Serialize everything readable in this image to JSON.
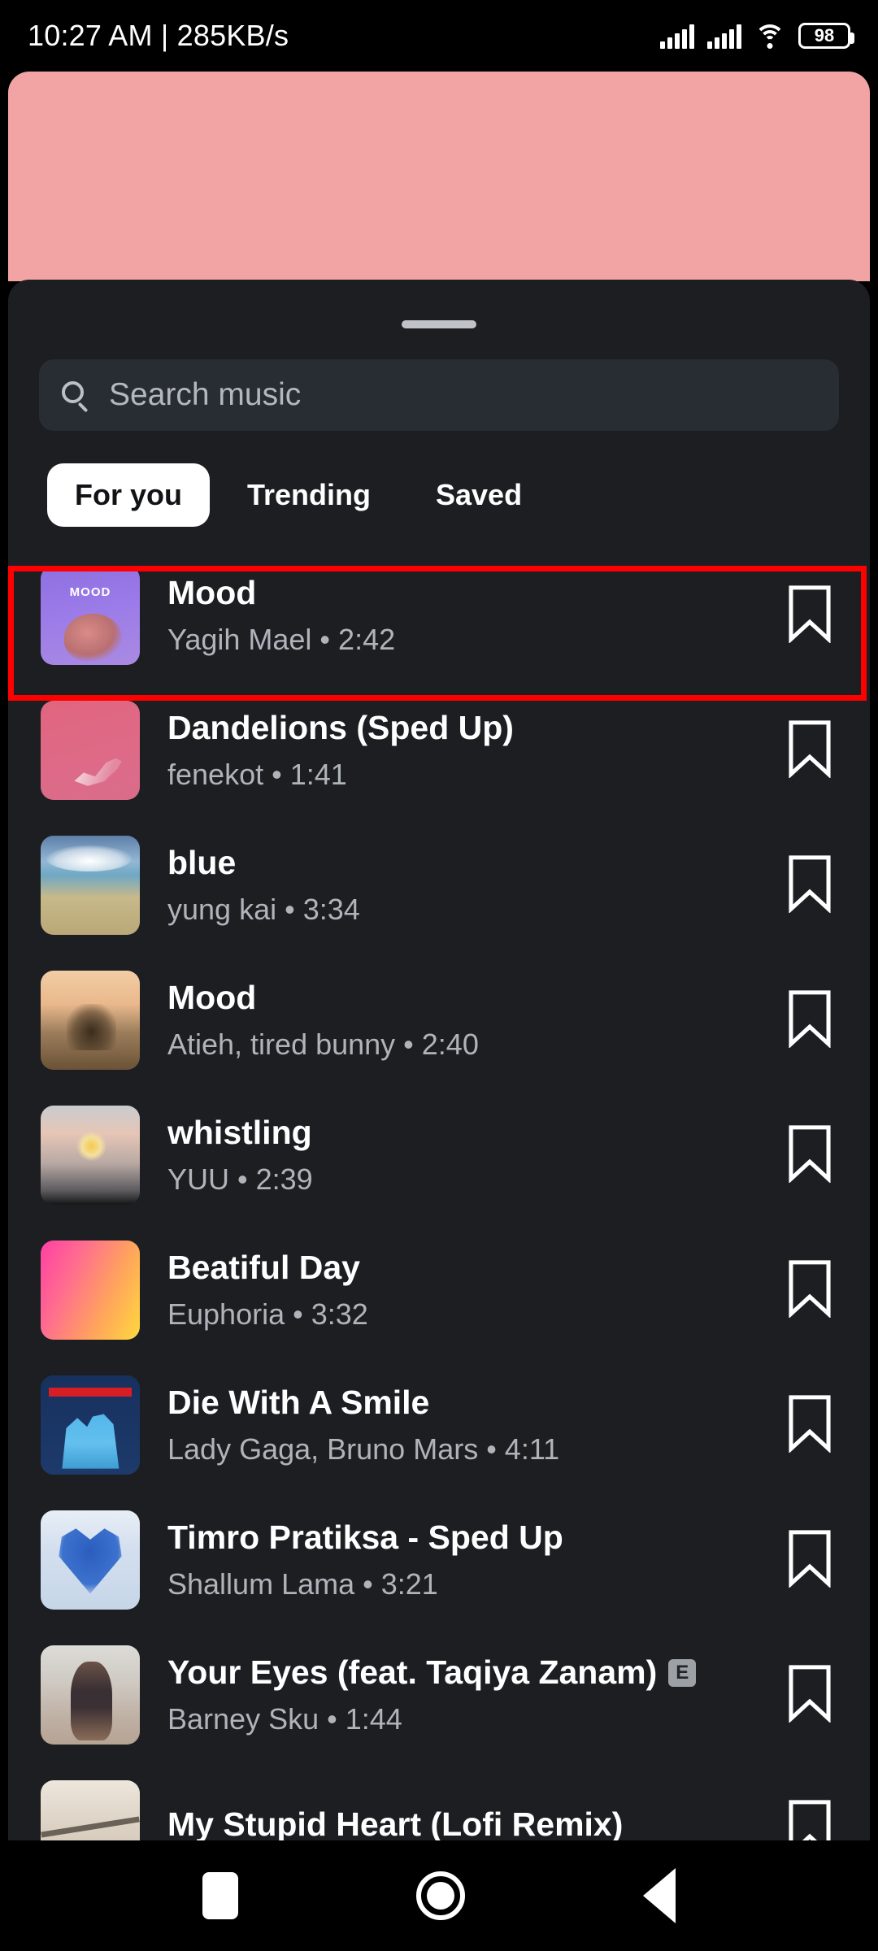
{
  "status_bar": {
    "time_and_speed": "10:27 AM | 285KB/s",
    "battery_level": "98",
    "icons": [
      "signal-icon",
      "signal-icon",
      "wifi-icon",
      "battery-icon"
    ]
  },
  "sheet": {
    "search": {
      "placeholder": "Search music",
      "value": "",
      "icon": "search-icon"
    },
    "tabs": [
      {
        "label": "For you",
        "active": true
      },
      {
        "label": "Trending",
        "active": false
      },
      {
        "label": "Saved",
        "active": false
      }
    ],
    "highlighted_row_index": 0,
    "highlight_color": "#FF0000",
    "tracks": [
      {
        "title": "Mood",
        "artist": "Yagih Mael",
        "duration": "2:42",
        "subtitle": "Yagih Mael • 2:42",
        "explicit": false,
        "art": "art-mood1",
        "art_label": "MOOD",
        "bookmark": "bookmark-icon"
      },
      {
        "title": "Dandelions (Sped Up)",
        "artist": "fenekot",
        "duration": "1:41",
        "subtitle": "fenekot • 1:41",
        "explicit": false,
        "art": "art-dand",
        "art_label": "",
        "bookmark": "bookmark-icon"
      },
      {
        "title": "blue",
        "artist": "yung kai",
        "duration": "3:34",
        "subtitle": "yung kai • 3:34",
        "explicit": false,
        "art": "art-blue",
        "art_label": "",
        "bookmark": "bookmark-icon"
      },
      {
        "title": "Mood",
        "artist": "Atieh, tired bunny",
        "duration": "2:40",
        "subtitle": "Atieh, tired bunny • 2:40",
        "explicit": false,
        "art": "art-moto",
        "art_label": "",
        "bookmark": "bookmark-icon"
      },
      {
        "title": "whistling",
        "artist": "YUU",
        "duration": "2:39",
        "subtitle": "YUU • 2:39",
        "explicit": false,
        "art": "art-whis",
        "art_label": "",
        "bookmark": "bookmark-icon"
      },
      {
        "title": "Beatiful Day",
        "artist": "Euphoria",
        "duration": "3:32",
        "subtitle": "Euphoria • 3:32",
        "explicit": false,
        "art": "art-beau",
        "art_label": "",
        "bookmark": "bookmark-icon"
      },
      {
        "title": "Die With A Smile",
        "artist": "Lady Gaga, Bruno Mars",
        "duration": "4:11",
        "subtitle": "Lady Gaga, Bruno Mars • 4:11",
        "explicit": false,
        "art": "art-die",
        "art_label": "",
        "bookmark": "bookmark-icon"
      },
      {
        "title": "Timro Pratiksa - Sped Up",
        "artist": "Shallum Lama",
        "duration": "3:21",
        "subtitle": "Shallum Lama • 3:21",
        "explicit": false,
        "art": "art-timro",
        "art_label": "",
        "bookmark": "bookmark-icon"
      },
      {
        "title": "Your Eyes (feat. Taqiya Zanam)",
        "artist": "Barney Sku",
        "duration": "1:44",
        "subtitle": "Barney Sku • 1:44",
        "explicit": true,
        "explicit_badge": "E",
        "art": "art-eyes",
        "art_label": "",
        "bookmark": "bookmark-icon"
      },
      {
        "title": "My Stupid Heart (Lofi Remix)",
        "artist": "",
        "duration": "",
        "subtitle": "",
        "explicit": false,
        "art": "art-stupid",
        "art_label": "",
        "bookmark": "bookmark-icon"
      }
    ]
  },
  "nav_bar": {
    "recents_label": "recents-button",
    "home_label": "home-button",
    "back_label": "back-button"
  }
}
